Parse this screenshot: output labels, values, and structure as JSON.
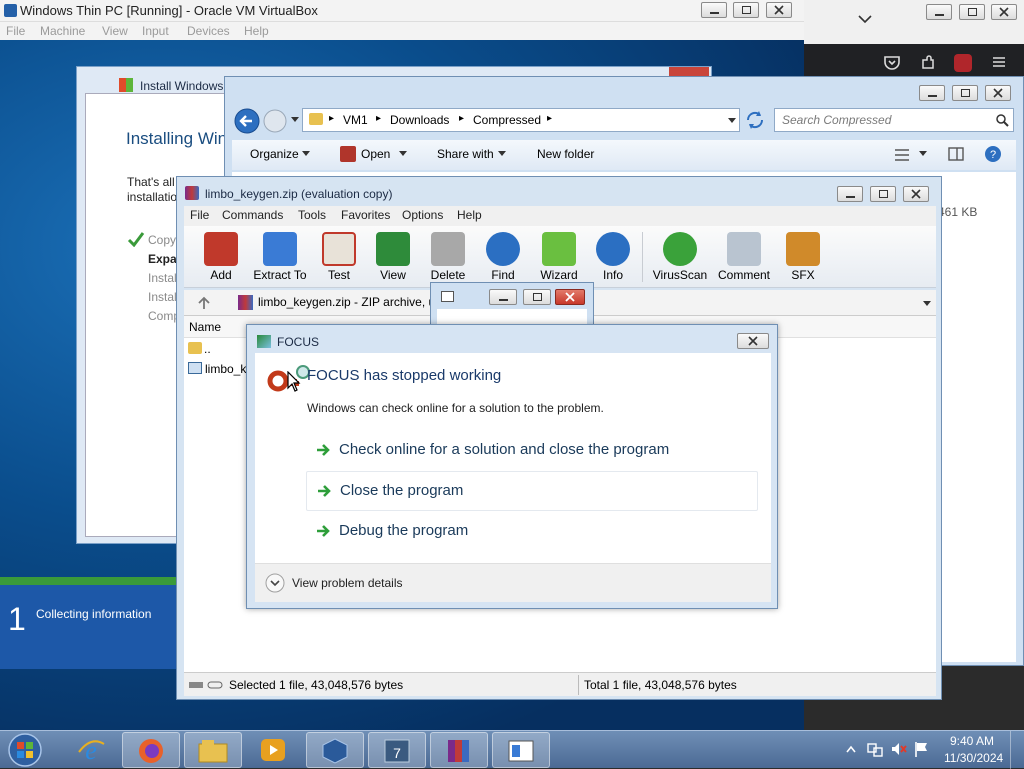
{
  "vbox": {
    "title": "Windows Thin PC [Running] - Oracle VM VirtualBox",
    "menu": [
      "File",
      "Machine",
      "View",
      "Input",
      "Devices",
      "Help"
    ]
  },
  "installer": {
    "title": "Install Windows",
    "heading": "Installing Windo",
    "body_line1": "That's all",
    "body_line2": "installatio",
    "steps": [
      "Copy",
      "Expa",
      "Instal",
      "Instal",
      "Comp"
    ],
    "progress_step_number": "1",
    "progress_step_label": "Collecting information"
  },
  "explorer": {
    "breadcrumb": [
      "VM1",
      "Downloads",
      "Compressed"
    ],
    "search_placeholder": "Search Compressed",
    "commands": {
      "organize": "Organize",
      "open": "Open",
      "share_with": "Share with",
      "new_folder": "New folder"
    },
    "size_fragment": "461 KB"
  },
  "winrar": {
    "title": "limbo_keygen.zip (evaluation copy)",
    "menu": [
      "File",
      "Commands",
      "Tools",
      "Favorites",
      "Options",
      "Help"
    ],
    "tools": [
      {
        "label": "Add",
        "icon": "add-archive-icon",
        "color": "#c0392b"
      },
      {
        "label": "Extract To",
        "icon": "extract-folder-icon",
        "color": "#3a7bd5"
      },
      {
        "label": "Test",
        "icon": "test-checklist-icon",
        "color": "#c0392b"
      },
      {
        "label": "View",
        "icon": "view-book-icon",
        "color": "#2e8b3a"
      },
      {
        "label": "Delete",
        "icon": "delete-trash-icon",
        "color": "#888888"
      },
      {
        "label": "Find",
        "icon": "find-magnifier-icon",
        "color": "#2b6fc2"
      },
      {
        "label": "Wizard",
        "icon": "wizard-wand-icon",
        "color": "#6abf40"
      },
      {
        "label": "Info",
        "icon": "info-icon",
        "color": "#2b6fc2"
      },
      {
        "label": "VirusScan",
        "icon": "virus-scan-icon",
        "color": "#3aa23a"
      },
      {
        "label": "Comment",
        "icon": "comment-icon",
        "color": "#8a9aaa"
      },
      {
        "label": "SFX",
        "icon": "sfx-books-icon",
        "color": "#d08a2a"
      }
    ],
    "path_text": "limbo_keygen.zip - ZIP archive, u",
    "list_header_name": "Name",
    "rows": [
      "..",
      "limbo_k"
    ],
    "status_left": "Selected 1 file, 43,048,576 bytes",
    "status_right": "Total 1 file, 43,048,576 bytes"
  },
  "focus_dialog": {
    "title": "FOCUS",
    "heading": "FOCUS has stopped working",
    "subtext": "Windows can check online for a solution to the problem.",
    "options": [
      "Check online for a solution and close the program",
      "Close the program",
      "Debug the program"
    ],
    "details": "View problem details"
  },
  "taskbar": {
    "time": "9:40 AM",
    "date": "11/30/2024",
    "apps": [
      "internet-explorer-icon",
      "firefox-icon",
      "file-explorer-icon",
      "media-player-icon",
      "virtualbox-icon",
      "pdf-app-icon",
      "winrar-icon",
      "focus-app-icon"
    ]
  },
  "colors": {
    "accent_blue": "#1a4d80",
    "arrow_green": "#2e9e3a",
    "desktop_blue": "#0a4d8c"
  }
}
